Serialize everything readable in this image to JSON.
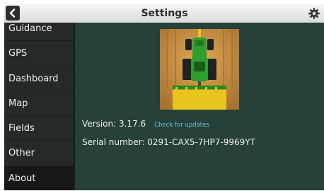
{
  "header": {
    "title": "Settings",
    "back_icon": "chevron-left-icon",
    "settings_icon": "gear-icon"
  },
  "sidebar": {
    "items": [
      {
        "label": "Guidance"
      },
      {
        "label": "GPS"
      },
      {
        "label": "Dashboard"
      },
      {
        "label": "Map"
      },
      {
        "label": "Fields"
      },
      {
        "label": "Other"
      },
      {
        "label": "About",
        "active": true
      }
    ]
  },
  "about": {
    "version_label": "Version: 3.17.6",
    "check_updates_label": "Check for updates",
    "serial_label": "Serial number: 0291-CAX5-7HP7-9969YT",
    "logo_icon": "tractor-icon"
  },
  "colors": {
    "sidebar_bg": "#232a27",
    "active_item_bg": "#151817",
    "content_bg": "#26403a",
    "link": "#6fc4cf",
    "tractor_green": "#2e9e2e",
    "implement_yellow": "#e8c51e",
    "logo_bg": "#c08a3e"
  }
}
